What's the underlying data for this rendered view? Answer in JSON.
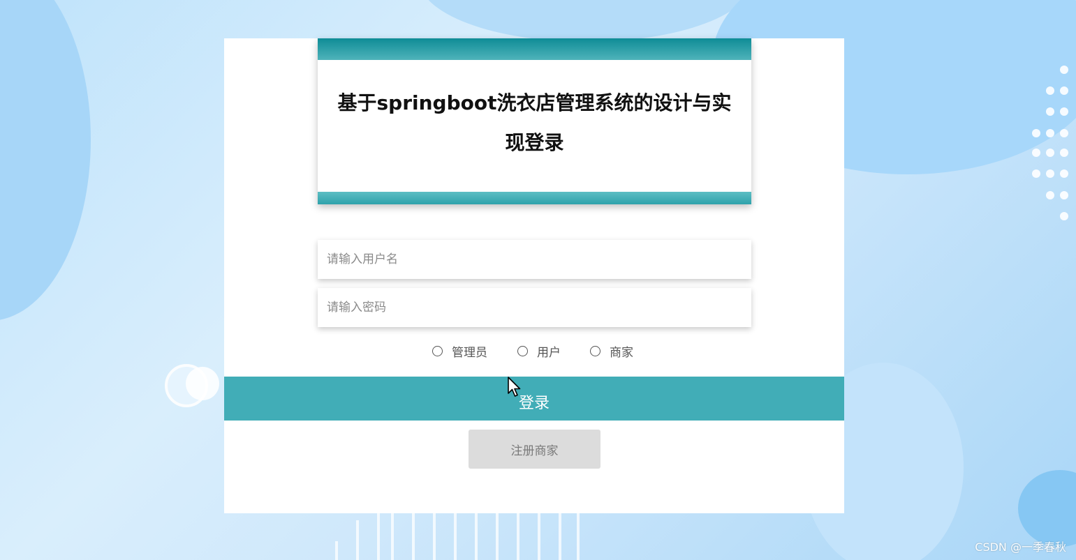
{
  "header": {
    "title": "基于springboot洗衣店管理系统的设计与实现登录"
  },
  "form": {
    "username_placeholder": "请输入用户名",
    "username_value": "",
    "password_placeholder": "请输入密码",
    "password_value": ""
  },
  "roles": [
    {
      "label": "管理员",
      "selected": false
    },
    {
      "label": "用户",
      "selected": false
    },
    {
      "label": "商家",
      "selected": false
    }
  ],
  "buttons": {
    "login_label": "登录",
    "register_label": "注册商家"
  },
  "watermark": "CSDN @一季春秋",
  "colors": {
    "accent": "#41adb7",
    "header_bar": "#0e8c96",
    "register_bg": "#dcdcdc"
  }
}
